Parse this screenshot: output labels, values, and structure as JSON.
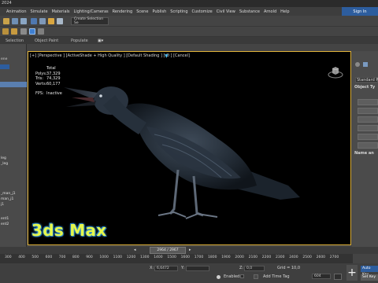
{
  "window": {
    "title_fragment": "2024"
  },
  "menu": [
    "Animation",
    "Simulate",
    "Materials",
    "Lighting/Cameras",
    "Rendering",
    "Scene",
    "Publish",
    "Scripting",
    "Customize",
    "Civil View",
    "Substance",
    "Arnold",
    "Help"
  ],
  "signin_label": "Sign In",
  "toolbar": {
    "selection_set_placeholder": "Create Selection Se"
  },
  "ribbon": {
    "tab_selection": "Selection",
    "tab_object_paint": "Object Paint",
    "tab_populate": "Populate"
  },
  "left_panel": {
    "header": "ene",
    "items": [
      "leg",
      "_leg",
      "_man_j1",
      "man_j1",
      "j1",
      "ent1",
      "ent2"
    ]
  },
  "viewport": {
    "label": "[+] [Perspective ] [ActiveShade + High Quality ] [Default Shading ] [ O ] [Cancel]",
    "stats": {
      "total_label": "Total",
      "polys_label": "Polys:",
      "polys_value": "37,329",
      "tris_label": "Tris:",
      "tris_value": "74,329",
      "verts_label": "Verts:",
      "verts_value": "60,177",
      "fps_label": "FPS:",
      "fps_value": "Inactive"
    },
    "watermark": "3ds Max"
  },
  "right_panel": {
    "dropdown": "Standard Prim",
    "rollout1": "Object Ty",
    "rollout2": "Name an"
  },
  "timeline": {
    "frame_indicator": "2964 / 2967",
    "ticks": [
      "300",
      "400",
      "500",
      "600",
      "700",
      "800",
      "900",
      "1000",
      "1100",
      "1200",
      "1300",
      "1400",
      "1500",
      "1600",
      "1700",
      "1800",
      "1900",
      "2000",
      "2100",
      "2200",
      "2300",
      "2400",
      "2500",
      "2600",
      "2700"
    ]
  },
  "status": {
    "x_label": "X:",
    "x_value": "6,6472",
    "y_label": "Y:",
    "y_value": "",
    "z_label": "Z:",
    "z_value": "0,0",
    "grid_label": "Grid = 10,0",
    "enabled_label": "Enabled:",
    "add_time_tag": "Add Time Tag",
    "auto_key": "Auto Key",
    "set_key": "Set Key",
    "selected": "604",
    "add_key_symbol": "+"
  },
  "colors": {
    "viewport_border": "#e2b43a",
    "accent_blue": "#2d5d9e",
    "watermark_fill": "#e6f74a"
  }
}
